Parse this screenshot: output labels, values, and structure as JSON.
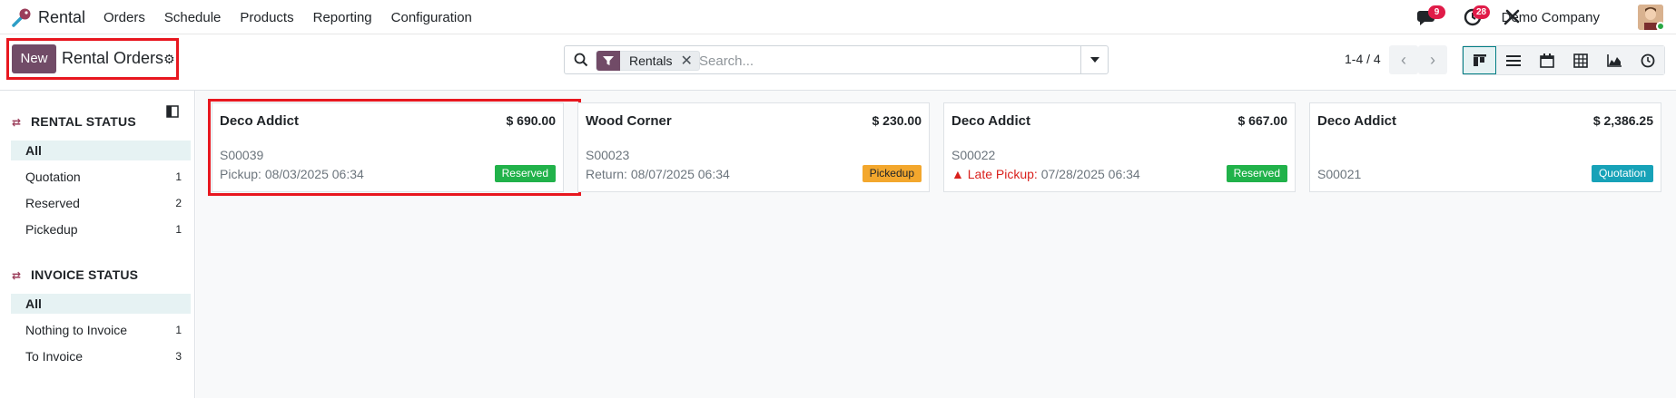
{
  "navbar": {
    "app_name": "Rental",
    "menu": [
      "Orders",
      "Schedule",
      "Products",
      "Reporting",
      "Configuration"
    ],
    "messages_count": "9",
    "activities_count": "28",
    "company": "Demo Company"
  },
  "control_panel": {
    "new_label": "New",
    "title": "Rental Orders",
    "search": {
      "facet": "Rentals",
      "placeholder": "Search..."
    },
    "pager": "1-4 / 4"
  },
  "sidebar": {
    "rental_status": {
      "header": "RENTAL STATUS",
      "items": [
        {
          "label": "All",
          "count": ""
        },
        {
          "label": "Quotation",
          "count": "1"
        },
        {
          "label": "Reserved",
          "count": "2"
        },
        {
          "label": "Pickedup",
          "count": "1"
        }
      ]
    },
    "invoice_status": {
      "header": "INVOICE STATUS",
      "items": [
        {
          "label": "All",
          "count": ""
        },
        {
          "label": "Nothing to Invoice",
          "count": "1"
        },
        {
          "label": "To Invoice",
          "count": "3"
        }
      ]
    }
  },
  "cards": [
    {
      "customer": "Deco Addict",
      "amount": "$ 690.00",
      "ref": "S00039",
      "date_label": "Pickup:",
      "date": "08/03/2025 06:34",
      "tag": "Reserved",
      "tag_color": "#21b24a",
      "late": false
    },
    {
      "customer": "Wood Corner",
      "amount": "$ 230.00",
      "ref": "S00023",
      "date_label": "Return:",
      "date": "08/07/2025 06:34",
      "tag": "Pickedup",
      "tag_color": "#f3a72d",
      "late": false
    },
    {
      "customer": "Deco Addict",
      "amount": "$ 667.00",
      "ref": "S00022",
      "date_label": "Late Pickup:",
      "date": "07/28/2025 06:34",
      "tag": "Reserved",
      "tag_color": "#21b24a",
      "late": true
    },
    {
      "customer": "Deco Addict",
      "amount": "$ 2,386.25",
      "ref": "S00021",
      "date_label": "",
      "date": "",
      "tag": "Quotation",
      "tag_color": "#17a2b8",
      "late": false
    }
  ]
}
